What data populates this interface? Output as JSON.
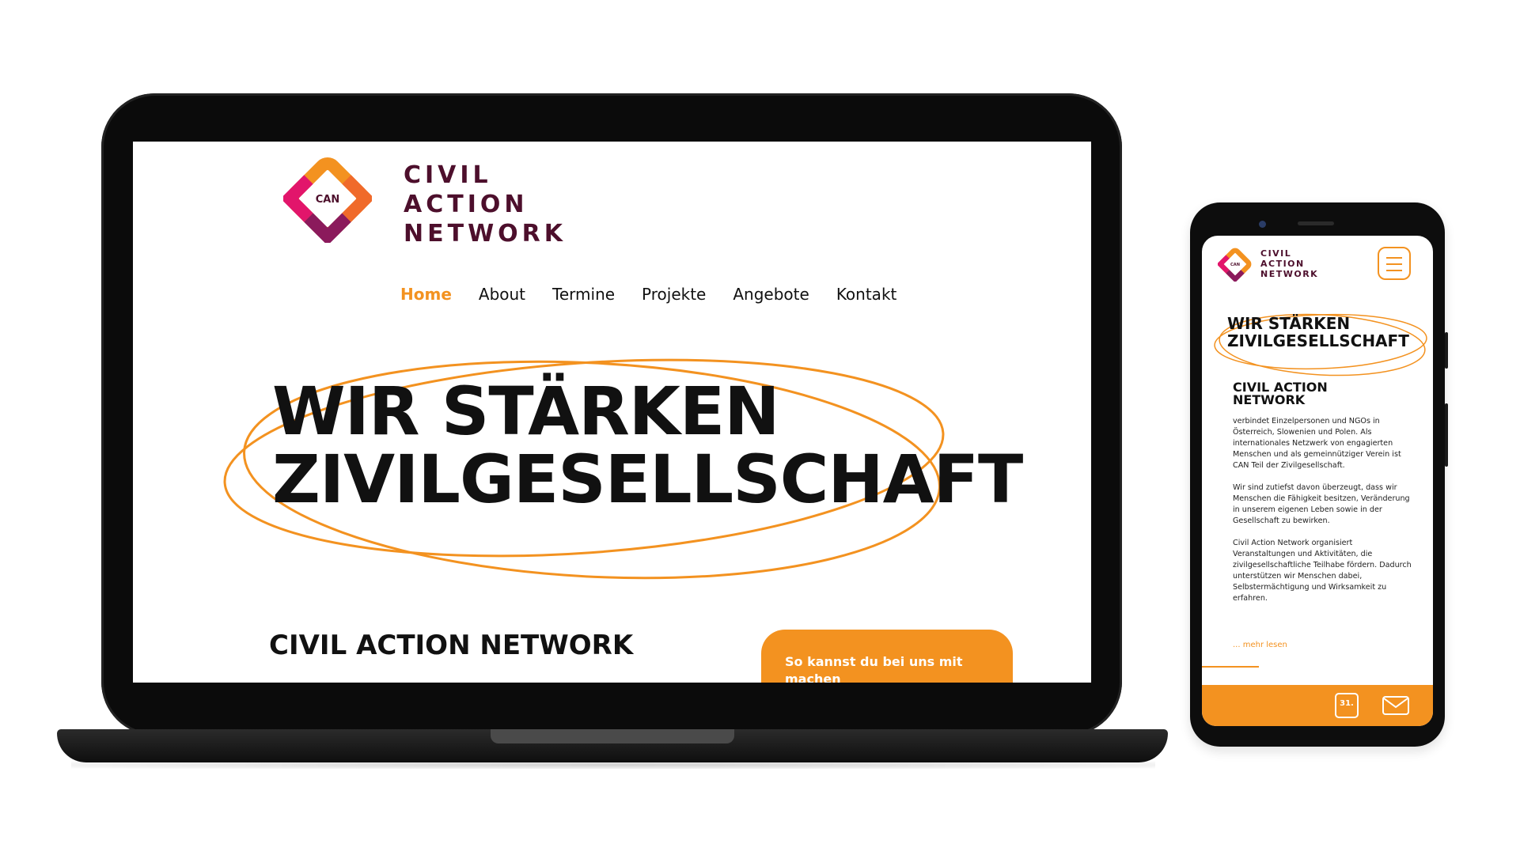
{
  "brand": {
    "line1": "CIVIL",
    "line2": "ACTION",
    "line3": "NETWORK",
    "logo_text": "CAN"
  },
  "nav": {
    "items": [
      {
        "label": "Home",
        "active": true
      },
      {
        "label": "About",
        "active": false
      },
      {
        "label": "Termine",
        "active": false
      },
      {
        "label": "Projekte",
        "active": false
      },
      {
        "label": "Angebote",
        "active": false
      },
      {
        "label": "Kontakt",
        "active": false
      }
    ]
  },
  "hero": {
    "line1": "WIR STÄRKEN",
    "line2": "ZIVILGESELLSCHAFT"
  },
  "section": {
    "title": "CIVIL ACTION NETWORK",
    "mobile_title_line1": "CIVIL ACTION",
    "mobile_title_line2": "NETWORK"
  },
  "cta": {
    "text": "So kannst du bei uns mit machen"
  },
  "mobile": {
    "paragraphs": [
      "verbindet Einzelpersonen und NGOs in Österreich, Slowenien und Polen. Als internationales Netzwerk von engagierten Menschen und als gemeinnütziger Verein ist CAN Teil der Zivilgesellschaft.",
      "Wir sind zutiefst davon überzeugt, dass wir Menschen die Fähigkeit besitzen, Veränderung in unserem eigenen Leben sowie in der Gesellschaft zu bewirken.",
      "Civil Action Network organisiert Veranstaltungen und Aktivitäten, die zivilgesellschaftliche Teilhabe fördern. Dadurch unterstützen wir Menschen dabei, Selbstermächtigung und Wirksamkeit zu erfahren."
    ],
    "more_link": "... mehr lesen",
    "calendar_day": "31."
  },
  "colors": {
    "accent": "#f39220",
    "brand_dark": "#4d0f2c",
    "logo_pink": "#e2156b",
    "logo_purple": "#8b1a5c"
  },
  "icons": [
    "can-logo-icon",
    "menu-icon",
    "calendar-icon",
    "mail-icon"
  ]
}
